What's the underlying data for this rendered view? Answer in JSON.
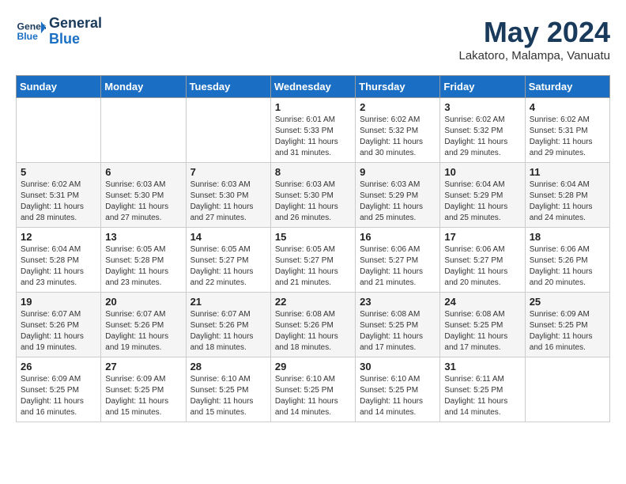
{
  "header": {
    "logo_line1": "General",
    "logo_line2": "Blue",
    "month": "May 2024",
    "location": "Lakatoro, Malampa, Vanuatu"
  },
  "weekdays": [
    "Sunday",
    "Monday",
    "Tuesday",
    "Wednesday",
    "Thursday",
    "Friday",
    "Saturday"
  ],
  "weeks": [
    [
      {
        "day": "",
        "info": ""
      },
      {
        "day": "",
        "info": ""
      },
      {
        "day": "",
        "info": ""
      },
      {
        "day": "1",
        "info": "Sunrise: 6:01 AM\nSunset: 5:33 PM\nDaylight: 11 hours and 31 minutes."
      },
      {
        "day": "2",
        "info": "Sunrise: 6:02 AM\nSunset: 5:32 PM\nDaylight: 11 hours and 30 minutes."
      },
      {
        "day": "3",
        "info": "Sunrise: 6:02 AM\nSunset: 5:32 PM\nDaylight: 11 hours and 29 minutes."
      },
      {
        "day": "4",
        "info": "Sunrise: 6:02 AM\nSunset: 5:31 PM\nDaylight: 11 hours and 29 minutes."
      }
    ],
    [
      {
        "day": "5",
        "info": "Sunrise: 6:02 AM\nSunset: 5:31 PM\nDaylight: 11 hours and 28 minutes."
      },
      {
        "day": "6",
        "info": "Sunrise: 6:03 AM\nSunset: 5:30 PM\nDaylight: 11 hours and 27 minutes."
      },
      {
        "day": "7",
        "info": "Sunrise: 6:03 AM\nSunset: 5:30 PM\nDaylight: 11 hours and 27 minutes."
      },
      {
        "day": "8",
        "info": "Sunrise: 6:03 AM\nSunset: 5:30 PM\nDaylight: 11 hours and 26 minutes."
      },
      {
        "day": "9",
        "info": "Sunrise: 6:03 AM\nSunset: 5:29 PM\nDaylight: 11 hours and 25 minutes."
      },
      {
        "day": "10",
        "info": "Sunrise: 6:04 AM\nSunset: 5:29 PM\nDaylight: 11 hours and 25 minutes."
      },
      {
        "day": "11",
        "info": "Sunrise: 6:04 AM\nSunset: 5:28 PM\nDaylight: 11 hours and 24 minutes."
      }
    ],
    [
      {
        "day": "12",
        "info": "Sunrise: 6:04 AM\nSunset: 5:28 PM\nDaylight: 11 hours and 23 minutes."
      },
      {
        "day": "13",
        "info": "Sunrise: 6:05 AM\nSunset: 5:28 PM\nDaylight: 11 hours and 23 minutes."
      },
      {
        "day": "14",
        "info": "Sunrise: 6:05 AM\nSunset: 5:27 PM\nDaylight: 11 hours and 22 minutes."
      },
      {
        "day": "15",
        "info": "Sunrise: 6:05 AM\nSunset: 5:27 PM\nDaylight: 11 hours and 21 minutes."
      },
      {
        "day": "16",
        "info": "Sunrise: 6:06 AM\nSunset: 5:27 PM\nDaylight: 11 hours and 21 minutes."
      },
      {
        "day": "17",
        "info": "Sunrise: 6:06 AM\nSunset: 5:27 PM\nDaylight: 11 hours and 20 minutes."
      },
      {
        "day": "18",
        "info": "Sunrise: 6:06 AM\nSunset: 5:26 PM\nDaylight: 11 hours and 20 minutes."
      }
    ],
    [
      {
        "day": "19",
        "info": "Sunrise: 6:07 AM\nSunset: 5:26 PM\nDaylight: 11 hours and 19 minutes."
      },
      {
        "day": "20",
        "info": "Sunrise: 6:07 AM\nSunset: 5:26 PM\nDaylight: 11 hours and 19 minutes."
      },
      {
        "day": "21",
        "info": "Sunrise: 6:07 AM\nSunset: 5:26 PM\nDaylight: 11 hours and 18 minutes."
      },
      {
        "day": "22",
        "info": "Sunrise: 6:08 AM\nSunset: 5:26 PM\nDaylight: 11 hours and 18 minutes."
      },
      {
        "day": "23",
        "info": "Sunrise: 6:08 AM\nSunset: 5:25 PM\nDaylight: 11 hours and 17 minutes."
      },
      {
        "day": "24",
        "info": "Sunrise: 6:08 AM\nSunset: 5:25 PM\nDaylight: 11 hours and 17 minutes."
      },
      {
        "day": "25",
        "info": "Sunrise: 6:09 AM\nSunset: 5:25 PM\nDaylight: 11 hours and 16 minutes."
      }
    ],
    [
      {
        "day": "26",
        "info": "Sunrise: 6:09 AM\nSunset: 5:25 PM\nDaylight: 11 hours and 16 minutes."
      },
      {
        "day": "27",
        "info": "Sunrise: 6:09 AM\nSunset: 5:25 PM\nDaylight: 11 hours and 15 minutes."
      },
      {
        "day": "28",
        "info": "Sunrise: 6:10 AM\nSunset: 5:25 PM\nDaylight: 11 hours and 15 minutes."
      },
      {
        "day": "29",
        "info": "Sunrise: 6:10 AM\nSunset: 5:25 PM\nDaylight: 11 hours and 14 minutes."
      },
      {
        "day": "30",
        "info": "Sunrise: 6:10 AM\nSunset: 5:25 PM\nDaylight: 11 hours and 14 minutes."
      },
      {
        "day": "31",
        "info": "Sunrise: 6:11 AM\nSunset: 5:25 PM\nDaylight: 11 hours and 14 minutes."
      },
      {
        "day": "",
        "info": ""
      }
    ]
  ]
}
